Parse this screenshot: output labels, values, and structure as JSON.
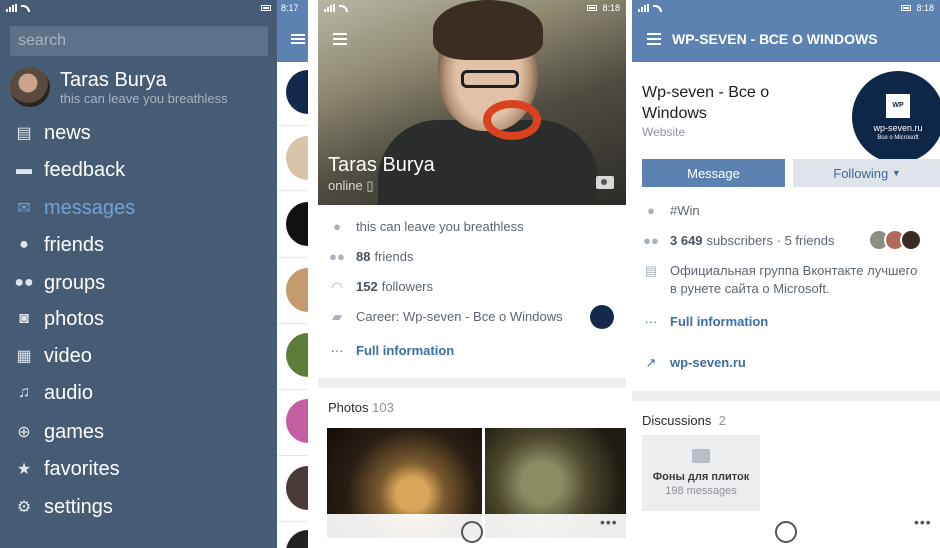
{
  "screen1": {
    "time": "8:17",
    "search_placeholder": "search",
    "profile": {
      "name": "Taras Burya",
      "status": "this can leave you breathless"
    },
    "menu": [
      {
        "label": "news",
        "icon": "news-icon"
      },
      {
        "label": "feedback",
        "icon": "speech-bubble-icon"
      },
      {
        "label": "messages",
        "icon": "envelope-icon",
        "active": true
      },
      {
        "label": "friends",
        "icon": "person-icon"
      },
      {
        "label": "groups",
        "icon": "people-icon"
      },
      {
        "label": "photos",
        "icon": "camera-icon"
      },
      {
        "label": "video",
        "icon": "film-icon"
      },
      {
        "label": "audio",
        "icon": "music-note-icon"
      },
      {
        "label": "games",
        "icon": "gamepad-icon"
      },
      {
        "label": "favorites",
        "icon": "star-icon"
      },
      {
        "label": "settings",
        "icon": "gear-icon"
      }
    ]
  },
  "screen2": {
    "time": "8:18",
    "name": "Taras Burya",
    "online": "online",
    "status_text": "this can leave you breathless",
    "friends_count": "88",
    "friends_label": "friends",
    "followers_count": "152",
    "followers_label": "followers",
    "career": "Career: Wp-seven - Все о Windows",
    "full_info": "Full information",
    "photos_label": "Photos",
    "photos_count": "103"
  },
  "screen3": {
    "time": "8:18",
    "header_title": "WP-SEVEN - ВСЕ О WINDOWS",
    "group_name": "Wp-seven - Все о Windows",
    "group_type": "Website",
    "logo_text": "wp-seven.ru",
    "logo_sub": "Все о Microsoft",
    "message_label": "Message",
    "following_label": "Following",
    "hashtag": "#Win",
    "subscribers_count": "3 649",
    "subscribers_label": "subscribers",
    "friends_text": "5 friends",
    "description": "Официальная группа Вконтакте лучшего в рунете сайта о Microsoft.",
    "full_info": "Full information",
    "website": "wp-seven.ru",
    "discussions_label": "Discussions",
    "discussions_count": "2",
    "discussion": {
      "title": "Фоны для плиток",
      "messages": "198 messages"
    }
  }
}
